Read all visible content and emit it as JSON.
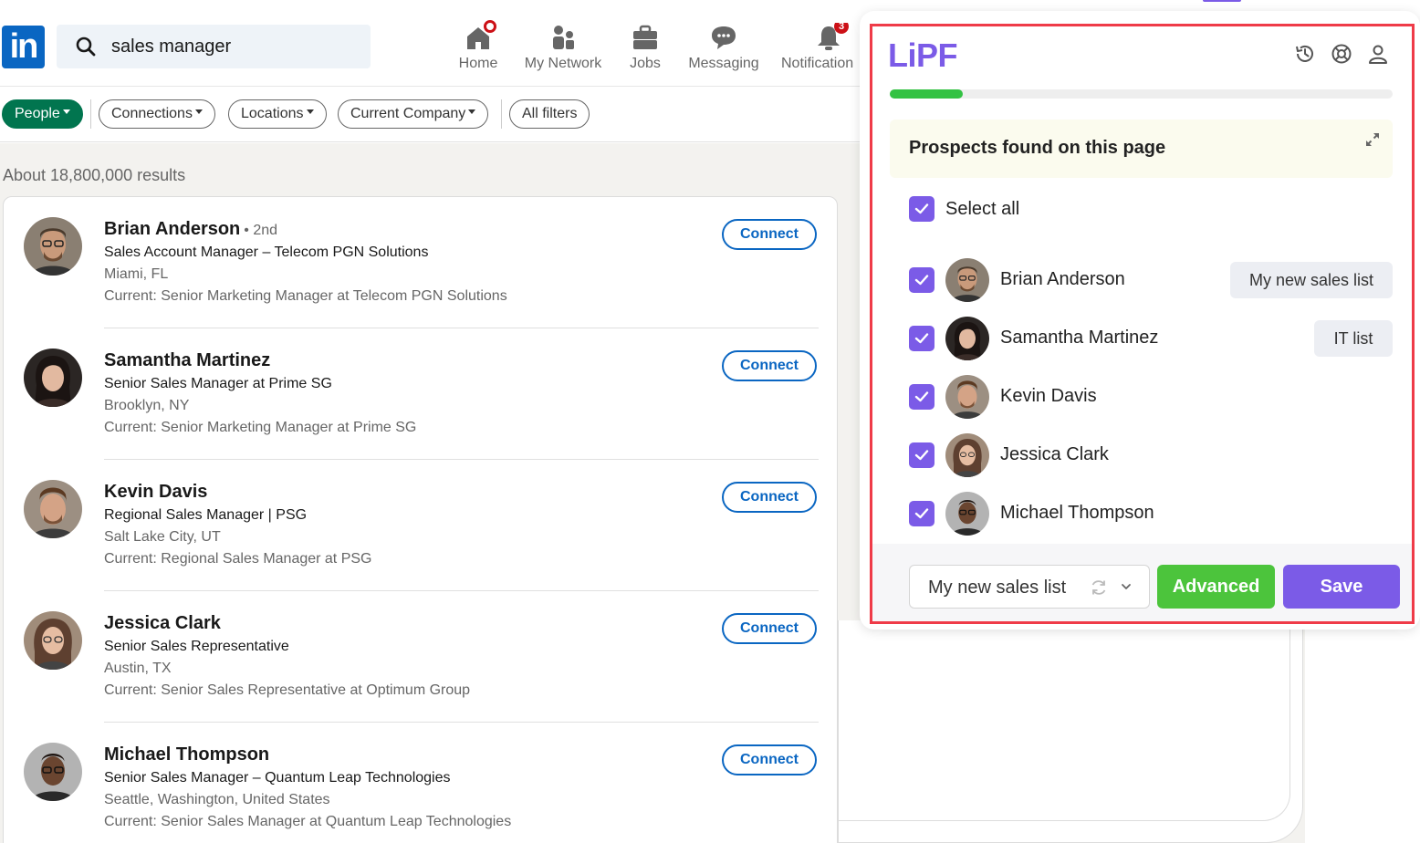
{
  "linkedin": {
    "logo": "in",
    "search_value": "sales manager",
    "nav": [
      {
        "label": "Home",
        "icon": "home-icon"
      },
      {
        "label": "My Network",
        "icon": "network-icon"
      },
      {
        "label": "Jobs",
        "icon": "briefcase-icon"
      },
      {
        "label": "Messaging",
        "icon": "chat-icon"
      },
      {
        "label": "Notification",
        "icon": "bell-icon",
        "badge": "3"
      }
    ],
    "filters": [
      {
        "label": "People",
        "active": true
      },
      {
        "label": "Connections"
      },
      {
        "label": "Locations"
      },
      {
        "label": "Current Company"
      },
      {
        "label": "All filters"
      }
    ],
    "results_count": "About 18,800,000 results",
    "results": [
      {
        "name": "Brian Anderson",
        "degree": "• 2nd",
        "headline": "Sales Account Manager  – Telecom PGN Solutions",
        "location": "Miami, FL",
        "current": "Current: Senior Marketing Manager at Telecom PGN Solutions",
        "action": "Connect"
      },
      {
        "name": "Samantha Martinez",
        "degree": "",
        "headline": "Senior Sales Manager at Prime SG",
        "location": "Brooklyn, NY",
        "current": "Current: Senior Marketing Manager at Prime SG",
        "action": "Connect"
      },
      {
        "name": "Kevin Davis",
        "degree": "",
        "headline": "Regional Sales Manager | PSG",
        "location": "Salt Lake City, UT",
        "current": "Current: Regional Sales Manager at PSG",
        "action": "Connect"
      },
      {
        "name": "Jessica Clark",
        "degree": "",
        "headline": "Senior Sales Representative",
        "location": "Austin, TX",
        "current": "Current: Senior Sales Representative at Optimum Group",
        "action": "Connect"
      },
      {
        "name": "Michael Thompson",
        "degree": "",
        "headline": "Senior Sales Manager – Quantum Leap Technologies",
        "location": "Seattle, Washington, United States",
        "current": "Current: Senior Sales Manager at Quantum Leap Technologies",
        "action": "Connect"
      }
    ]
  },
  "lipf": {
    "logo": "LiPF",
    "header_icons": [
      "history-icon",
      "support-icon",
      "profile-icon"
    ],
    "progress": 0.145,
    "prospects_title": "Prospects found on this page",
    "select_all_label": "Select all",
    "prospects": [
      {
        "name": "Brian Anderson",
        "checked": true,
        "list": "My new sales list"
      },
      {
        "name": "Samantha Martinez",
        "checked": true,
        "list": "IT list"
      },
      {
        "name": "Kevin Davis",
        "checked": true,
        "list": ""
      },
      {
        "name": "Jessica Clark",
        "checked": true,
        "list": ""
      },
      {
        "name": "Michael Thompson",
        "checked": true,
        "list": ""
      }
    ],
    "list_select_value": "My new sales list",
    "advanced_label": "Advanced",
    "save_label": "Save"
  },
  "colors": {
    "linkedin_blue": "#0a66c2",
    "people_green": "#01754f",
    "lipf_purple": "#7b5be7",
    "advanced_green": "#4cc43c",
    "progress_green": "#33c243",
    "highlight_red": "#ef3b48"
  }
}
